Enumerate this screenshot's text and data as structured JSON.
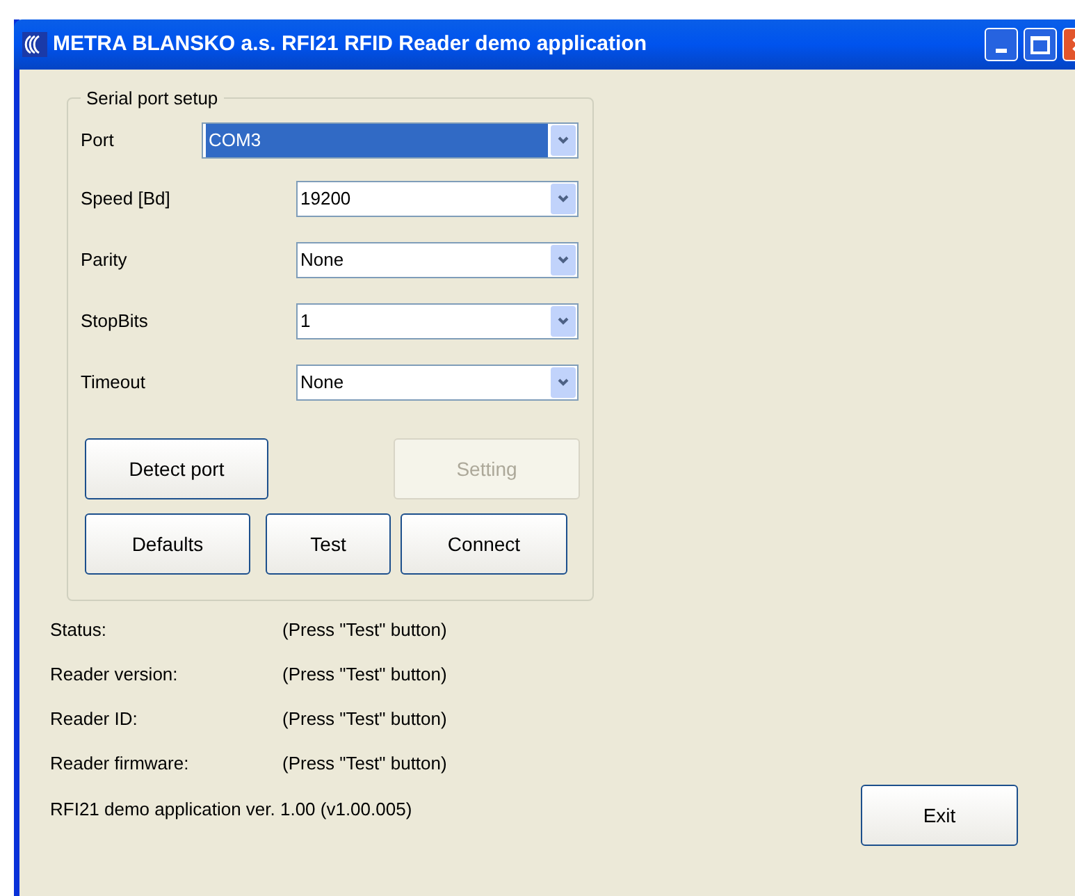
{
  "window": {
    "title": "METRA BLANSKO a.s. RFI21 RFID Reader demo application"
  },
  "serial_port_setup": {
    "title": "Serial port setup",
    "fields": [
      {
        "label": "Port",
        "value": "COM3",
        "selected": true
      },
      {
        "label": "Speed [Bd]",
        "value": "19200",
        "selected": false
      },
      {
        "label": "Parity",
        "value": "None",
        "selected": false
      },
      {
        "label": "StopBits",
        "value": "1",
        "selected": false
      },
      {
        "label": "Timeout",
        "value": "None",
        "selected": false
      }
    ],
    "buttons_row_1": [
      {
        "label": "Detect port",
        "disabled": false
      },
      {
        "label": "Setting",
        "disabled": true
      }
    ],
    "buttons_row_2": [
      {
        "label": "Defaults",
        "disabled": false
      },
      {
        "label": "Test",
        "disabled": false
      },
      {
        "label": "Connect",
        "disabled": false
      }
    ]
  },
  "info": [
    {
      "label": "Status:",
      "value": "(Press \"Test\" button)"
    },
    {
      "label": "Reader version:",
      "value": "(Press \"Test\" button)"
    },
    {
      "label": "Reader ID:",
      "value": "(Press \"Test\" button)"
    },
    {
      "label": "Reader firmware:",
      "value": "(Press \"Test\" button)"
    }
  ],
  "version_text": "RFI21 demo application ver. 1.00 (v1.00.005)",
  "exit_button": {
    "label": "Exit",
    "disabled": false
  }
}
